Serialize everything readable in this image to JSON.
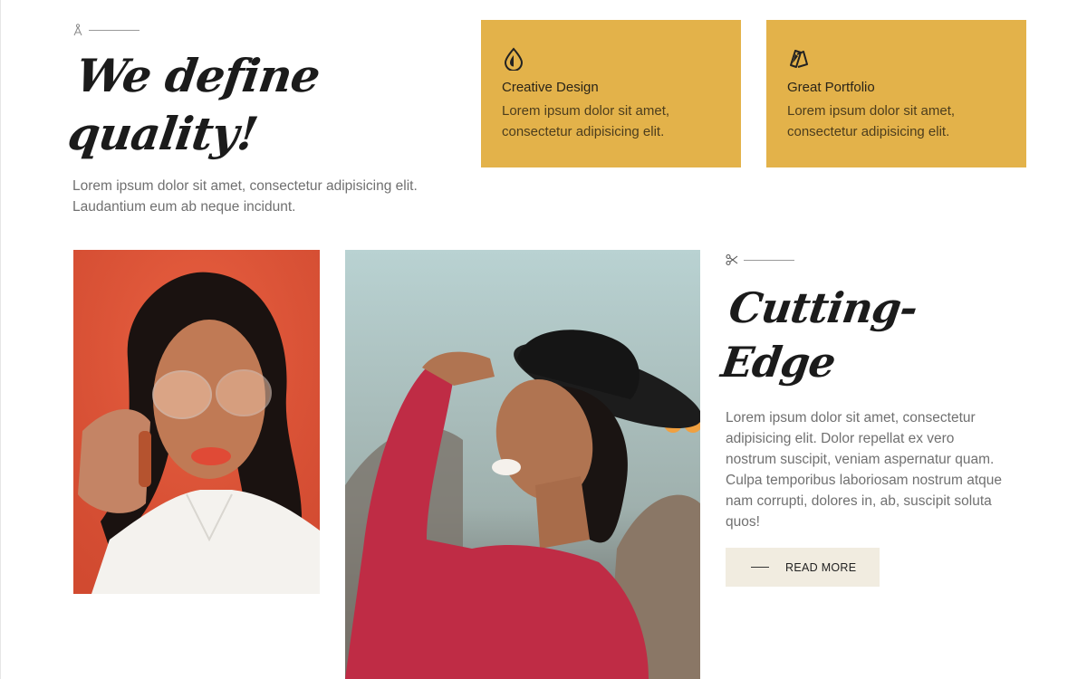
{
  "intro": {
    "icon": "compass-icon",
    "title": "We define quality!",
    "text": "Lorem ipsum dolor sit amet, consectetur adipisicing elit. Laudantium eum ab neque incidunt."
  },
  "cards": [
    {
      "icon": "drop-icon",
      "title": "Creative Design",
      "text": "Lorem ipsum dolor sit amet, consectetur adipisicing elit."
    },
    {
      "icon": "swatches-icon",
      "title": "Great Portfolio",
      "text": "Lorem ipsum dolor sit amet, consectetur adipisicing elit."
    }
  ],
  "photos": [
    {
      "subject": "woman-with-glasses-photo"
    },
    {
      "subject": "woman-with-black-hat-photo"
    }
  ],
  "edge": {
    "icon": "scissors-icon",
    "title": "Cutting-Edge",
    "text": "Lorem ipsum dolor sit amet, consectetur adipisicing elit. Dolor repellat ex vero nostrum suscipit, veniam aspernatur quam. Culpa temporibus laboriosam nostrum atque nam corrupti, dolores in, ab, suscipit soluta quos!",
    "button_label": "READ MORE"
  },
  "colors": {
    "accent": "#e3b24a",
    "button_bg": "#f1ece0",
    "heading": "#1b1b1b",
    "body_text": "#707070"
  }
}
